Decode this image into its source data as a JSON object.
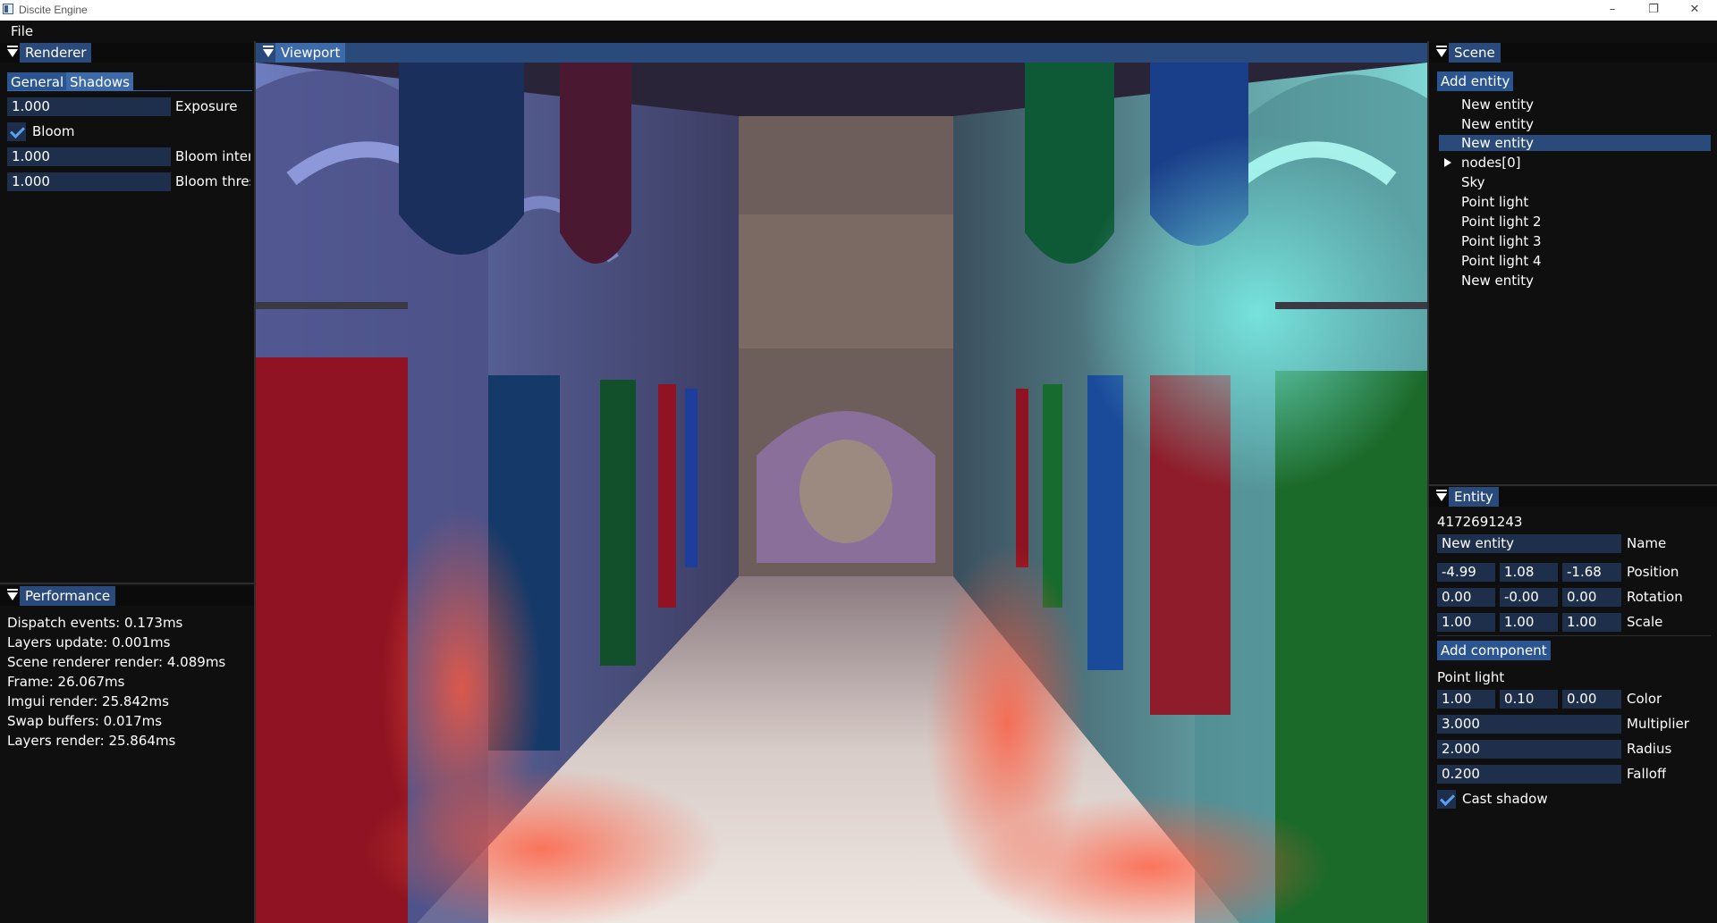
{
  "window": {
    "title": "Discite Engine",
    "minimize": "–",
    "maximize": "❐",
    "close": "✕"
  },
  "menu": {
    "file": "File"
  },
  "renderer": {
    "header": "Renderer",
    "tabs": [
      "General",
      "Shadows"
    ],
    "exposure": {
      "value": "1.000",
      "label": "Exposure"
    },
    "bloom": {
      "label": "Bloom",
      "checked": true
    },
    "bloom_intensity": {
      "value": "1.000",
      "label": "Bloom inten:"
    },
    "bloom_threshold": {
      "value": "1.000",
      "label": "Bloom thres"
    }
  },
  "performance": {
    "header": "Performance",
    "lines": [
      "Dispatch events: 0.173ms",
      "Layers update: 0.001ms",
      "Scene renderer render: 4.089ms",
      "Frame: 26.067ms",
      "Imgui render: 25.842ms",
      "Swap buffers: 0.017ms",
      "Layers render: 25.864ms"
    ]
  },
  "viewport": {
    "header": "Viewport"
  },
  "scene": {
    "header": "Scene",
    "add_entity": "Add entity",
    "items": [
      "New entity",
      "New entity",
      "New entity",
      "nodes[0]",
      "Sky",
      "Point light",
      "Point light 2",
      "Point light 3",
      "Point light 4",
      "New entity"
    ],
    "selected_index": 2
  },
  "entity": {
    "header": "Entity",
    "id": "4172691243",
    "name": {
      "value": "New entity",
      "label": "Name"
    },
    "position": {
      "values": [
        "-4.99",
        "1.08",
        "-1.68"
      ],
      "label": "Position"
    },
    "rotation": {
      "values": [
        "0.00",
        "-0.00",
        "0.00"
      ],
      "label": "Rotation"
    },
    "scale": {
      "values": [
        "1.00",
        "1.00",
        "1.00"
      ],
      "label": "Scale"
    },
    "add_component": "Add component",
    "point_light": {
      "title": "Point light",
      "color": {
        "values": [
          "1.00",
          "0.10",
          "0.00"
        ],
        "label": "Color"
      },
      "multiplier": {
        "value": "3.000",
        "label": "Multiplier"
      },
      "radius": {
        "value": "2.000",
        "label": "Radius"
      },
      "falloff": {
        "value": "0.200",
        "label": "Falloff"
      },
      "cast_shadow": {
        "label": "Cast shadow",
        "checked": true
      }
    }
  },
  "colors": {
    "header_active": "#294a7a",
    "button": "#2b5590",
    "field": "#1d2f4a",
    "check": "#5aa0f0",
    "background": "#0f0f0f"
  }
}
